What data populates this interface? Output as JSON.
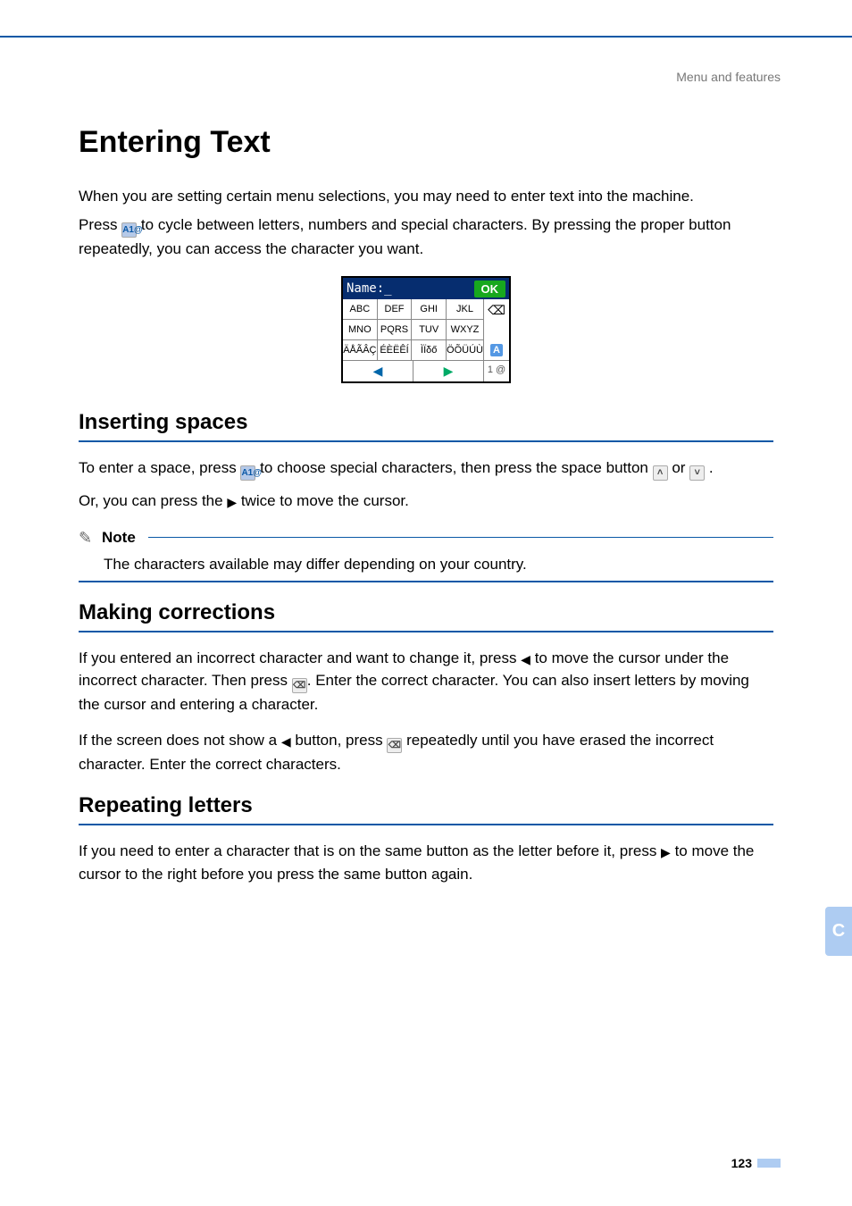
{
  "header": {
    "breadcrumb": "Menu and features"
  },
  "title": "Entering Text",
  "intro": {
    "line1": "When you are setting certain menu selections, you may need to enter text into the machine.",
    "line2a": "Press ",
    "line2b": " to cycle between letters, numbers and special characters. By pressing the proper button repeatedly, you can access the character you want."
  },
  "icons": {
    "mode": "A1@",
    "caret": "˄",
    "underscore": "˅"
  },
  "device": {
    "name_label": "Name:_",
    "ok": "OK",
    "keys": [
      "ABC",
      "DEF",
      "GHI",
      "JKL",
      "MNO",
      "PQRS",
      "TUV",
      "WXYZ",
      "ÄÅÃÂÇ",
      "ÉÈËÊÍ",
      "ÌÏδő",
      "ÖÕÜÚÙ"
    ],
    "mode_top": "A",
    "mode_bottom": "1 @"
  },
  "sections": [
    {
      "heading": "Inserting spaces",
      "p1a": "To enter a space, press ",
      "p1b": " to choose special characters, then press the space button ",
      "p1c": " or ",
      "p1d": ".",
      "p2a": "Or, you can press the ",
      "p2b": " twice to move the cursor."
    },
    {
      "heading": "Making corrections",
      "p1a": "If you entered an incorrect character and want to change it, press ",
      "p1b": " to move the cursor under the incorrect character. Then press ",
      "p1c": ". Enter the correct character. You can also insert letters by moving the cursor and entering a character.",
      "p2a": "If the screen does not show a ",
      "p2b": " button, press ",
      "p2c": " repeatedly until you have erased the incorrect character. Enter the correct characters."
    },
    {
      "heading": "Repeating letters",
      "p1a": "If you need to enter a character that is on the same button as the letter before it, press ",
      "p1b": " to move the cursor to the right before you press the same button again."
    }
  ],
  "note": {
    "label": "Note",
    "body": "The characters available may differ depending on your country."
  },
  "side_tab": "C",
  "footer": {
    "page": "123"
  }
}
